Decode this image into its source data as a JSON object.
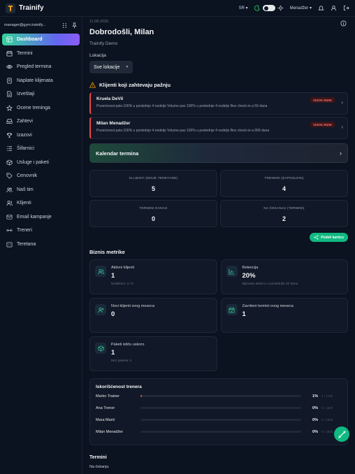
{
  "app": {
    "name": "Trainify"
  },
  "topbar": {
    "language": "SR",
    "user_name": "Menadžer"
  },
  "account": {
    "email": "manager@gym.trainify..."
  },
  "nav": [
    {
      "label": "Dashboard",
      "icon": "dashboard-icon",
      "active": true
    },
    {
      "label": "Termini",
      "icon": "calendar-icon"
    },
    {
      "label": "Pregled termina",
      "icon": "eye-icon"
    },
    {
      "label": "Naplate klijenata",
      "icon": "billing-icon"
    },
    {
      "label": "Izveštaji",
      "icon": "report-icon"
    },
    {
      "label": "Ocene treninga",
      "icon": "star-icon"
    },
    {
      "label": "Zahtevi",
      "icon": "inbox-icon"
    },
    {
      "label": "Izazovi",
      "icon": "trophy-icon"
    },
    {
      "label": "Šifarnici",
      "icon": "list-icon"
    },
    {
      "label": "Usluge i paketi",
      "icon": "package-icon"
    },
    {
      "label": "Cenovnik",
      "icon": "tag-icon"
    },
    {
      "label": "Naš tim",
      "icon": "team-icon"
    },
    {
      "label": "Klijenti",
      "icon": "clients-icon"
    },
    {
      "label": "Email kampanje",
      "icon": "mail-icon"
    },
    {
      "label": "Treneri",
      "icon": "trainer-icon"
    },
    {
      "label": "Teretana",
      "icon": "gym-icon"
    }
  ],
  "main": {
    "date": "11.08.2026.",
    "welcome": "Dobrodošli, Milan",
    "subtitle": "Trainify Demo",
    "location_label": "Lokacija",
    "location_value": "Sve lokacije",
    "alerts_title": "Klijenti koji zahtevaju pažnju",
    "alerts": [
      {
        "name": "Kruela DeVil",
        "desc": "Posećenost pala 100% u poslednje 4 nedelje Volume pao 100% u poslednje 4 nedelje Bez check-in-a 59 dana",
        "badge": "VISOK RIZIK"
      },
      {
        "name": "Milan Menadžer",
        "desc": "Posećenost pala 100% u poslednje 4 nedelje Volume pao 100% u poslednje 4 nedelje Bez check-in-a 999 dana",
        "badge": "VISOK RIZIK"
      }
    ],
    "calendar_label": "Kalendar termina",
    "stats": [
      {
        "label": "KLIJENTI (MOJE TERETANE)",
        "value": "5"
      },
      {
        "label": "TRENERI (ZAPOSLENI)",
        "value": "4"
      },
      {
        "label": "TERMINI DANAS",
        "value": "0"
      },
      {
        "label": "NA ČEKANJU (TERMINI)",
        "value": "2"
      }
    ],
    "share_button": "Podeli karticu",
    "metrics_title": "Biznis metrike",
    "metrics": [
      {
        "label": "Aktivni klijenti",
        "value": "1",
        "sub": "Neaktivni: 4 / 5",
        "icon": "users-icon"
      },
      {
        "label": "Retencija",
        "value": "20%",
        "sub": "klijenata aktivno u poslednjih 30 dana",
        "icon": "chart-icon"
      },
      {
        "label": "Novi klijenti ovog meseca",
        "value": "0",
        "sub": "",
        "icon": "user-plus-icon"
      },
      {
        "label": "Završeni termini ovog meseca",
        "value": "1",
        "sub": "",
        "icon": "calendar-check-icon"
      },
      {
        "label": "Paketi ističu uskoro",
        "value": "1",
        "sub": "Bez paketa: 4",
        "icon": "box-icon"
      }
    ],
    "usage_title": "Iskorišćenost trenera",
    "trainers": [
      {
        "name": "Marko Trainer",
        "percent": "1%",
        "hours": "1 / 176h",
        "fill": 0.01
      },
      {
        "name": "Ana Trener",
        "percent": "0%",
        "hours": "0 / 160h",
        "fill": 0
      },
      {
        "name": "Mara Marić",
        "percent": "0%",
        "hours": "0 / 160h",
        "fill": 0
      },
      {
        "name": "Milan Menadžer",
        "percent": "0%",
        "hours": "0 / 160h",
        "fill": 0
      }
    ],
    "termini_title": "Termini",
    "termini_sub": "Na čekanju"
  },
  "colors": {
    "accent_green": "#10b981",
    "accent_purple": "#8b5cf6",
    "danger": "#ef4444"
  }
}
